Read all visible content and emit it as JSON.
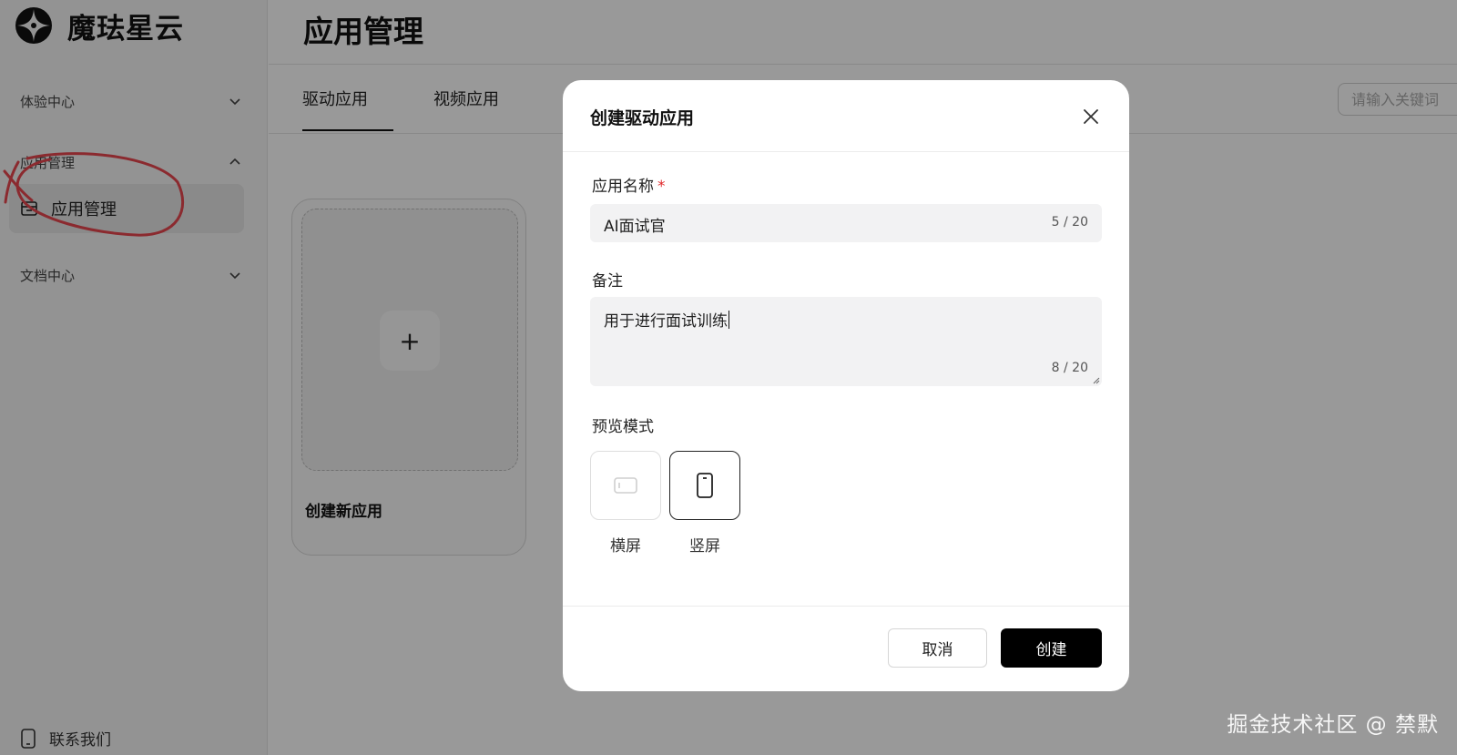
{
  "brand": {
    "name": "魔珐星云",
    "logo_icon": "star-quadrant-icon"
  },
  "sidebar": {
    "groups": [
      {
        "label": "体验中心",
        "icon": "chevron-down-icon"
      },
      {
        "label": "应用管理",
        "icon": "chevron-up-icon"
      },
      {
        "label": "文档中心",
        "icon": "chevron-down-icon"
      }
    ],
    "active_item": {
      "label": "应用管理",
      "icon": "folder-icon"
    },
    "contact": {
      "label": "联系我们",
      "icon": "phone-icon"
    }
  },
  "main": {
    "title": "应用管理",
    "tabs": [
      {
        "label": "驱动应用",
        "active": true
      },
      {
        "label": "视频应用",
        "active": false
      }
    ],
    "search_placeholder": "请输入关键词",
    "new_app_card": {
      "label": "创建新应用",
      "plus": "+"
    }
  },
  "modal": {
    "title": "创建驱动应用",
    "name_field": {
      "label": "应用名称",
      "required_mark": "*",
      "value": "AI面试官",
      "counter": "5 / 20"
    },
    "note_field": {
      "label": "备注",
      "value": "用于进行面试训练",
      "counter": "8 / 20"
    },
    "preview_mode": {
      "label": "预览模式",
      "options": [
        {
          "label": "横屏",
          "icon": "landscape-device-icon",
          "selected": false
        },
        {
          "label": "竖屏",
          "icon": "portrait-device-icon",
          "selected": true
        }
      ]
    },
    "cancel_label": "取消",
    "create_label": "创建"
  },
  "watermark": "掘金技术社区 @ 禁默",
  "colors": {
    "accent": "#000000",
    "required": "#e0292b",
    "annotation": "#e8474f"
  }
}
